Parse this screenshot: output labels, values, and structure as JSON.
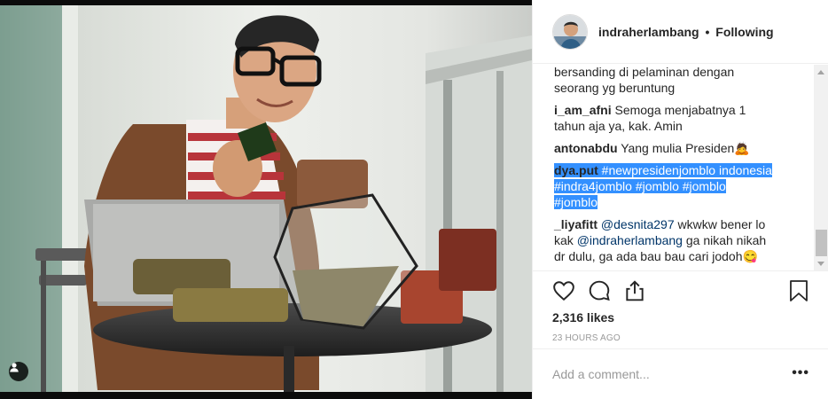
{
  "post": {
    "username": "indraherlambang",
    "separator": "•",
    "follow_status": "Following",
    "caption_tail": [
      "bersanding di pelaminan dengan",
      "seorang yg beruntung"
    ],
    "comments": [
      {
        "user": "i_am_afni",
        "lines": [
          "Semoga menjabatnya 1",
          "tahun aja ya, kak. Amin"
        ]
      },
      {
        "user": "antonabdu",
        "text": "Yang mulia Presiden🙇"
      },
      {
        "user": "dya.put",
        "hashtags": [
          "#newpresidenjomblo indonesia"
        ],
        "line1_tag": "#newpresidenjomblo indonesia",
        "line2": "#indra4jomblo #jomblo #jomblo",
        "line3": "#jomblo"
      },
      {
        "user": "_liyafitt",
        "mention1": "@desnita297",
        "text1": " wkwkw bener lo",
        "text2_pre": "kak ",
        "mention2": "@indraherlambang",
        "text2_post": " ga nikah nikah",
        "text3": "dr dulu, ga ada bau bau cari jodoh😋"
      }
    ],
    "likes": "2,316 likes",
    "timestamp": "23 HOURS AGO",
    "add_comment_placeholder": "Add a comment...",
    "more_label": "•••"
  },
  "icons": {
    "like": "heart-icon",
    "comment": "comment-icon",
    "share": "share-icon",
    "save": "bookmark-icon",
    "tag": "user-tag-icon"
  },
  "colors": {
    "link": "#003569",
    "selection": "#3390ff",
    "muted": "#999999",
    "text": "#262626"
  }
}
